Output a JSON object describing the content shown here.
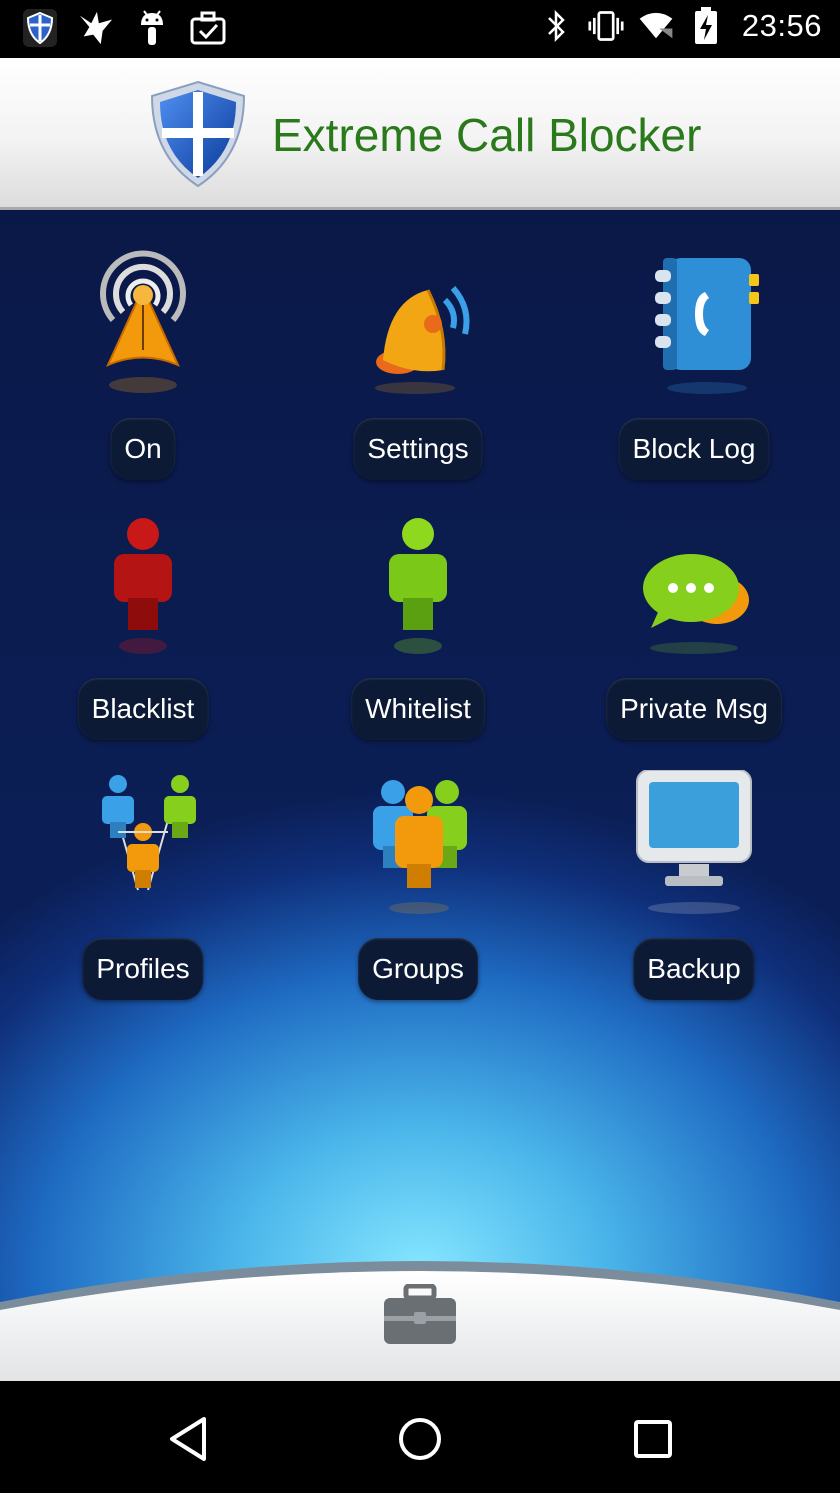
{
  "status_bar": {
    "time": "23:56",
    "left_icons": [
      "shield-notification-icon",
      "bird-notification-icon",
      "android-debug-icon",
      "briefcase-check-icon"
    ],
    "right_icons": [
      "bluetooth-icon",
      "vibrate-icon",
      "wifi-icon",
      "battery-charging-icon"
    ]
  },
  "header": {
    "title": "Extreme Call Blocker"
  },
  "grid": {
    "items": [
      {
        "label": "On",
        "icon": "broadcast-tower-icon"
      },
      {
        "label": "Settings",
        "icon": "satellite-dish-icon"
      },
      {
        "label": "Block Log",
        "icon": "phone-book-icon"
      },
      {
        "label": "Blacklist",
        "icon": "red-person-icon"
      },
      {
        "label": "Whitelist",
        "icon": "green-person-icon"
      },
      {
        "label": "Private Msg",
        "icon": "chat-bubbles-icon"
      },
      {
        "label": "Profiles",
        "icon": "profiles-tree-icon"
      },
      {
        "label": "Groups",
        "icon": "group-people-icon"
      },
      {
        "label": "Backup",
        "icon": "monitor-icon"
      }
    ]
  },
  "dock": {
    "icon": "toolbox-icon"
  },
  "nav_bar": {
    "buttons": [
      "back-icon",
      "home-icon",
      "recents-icon"
    ]
  },
  "colors": {
    "title_green": "#2a7a1c",
    "pill_bg": "#0c1a36",
    "accent_orange": "#f29a0b"
  }
}
